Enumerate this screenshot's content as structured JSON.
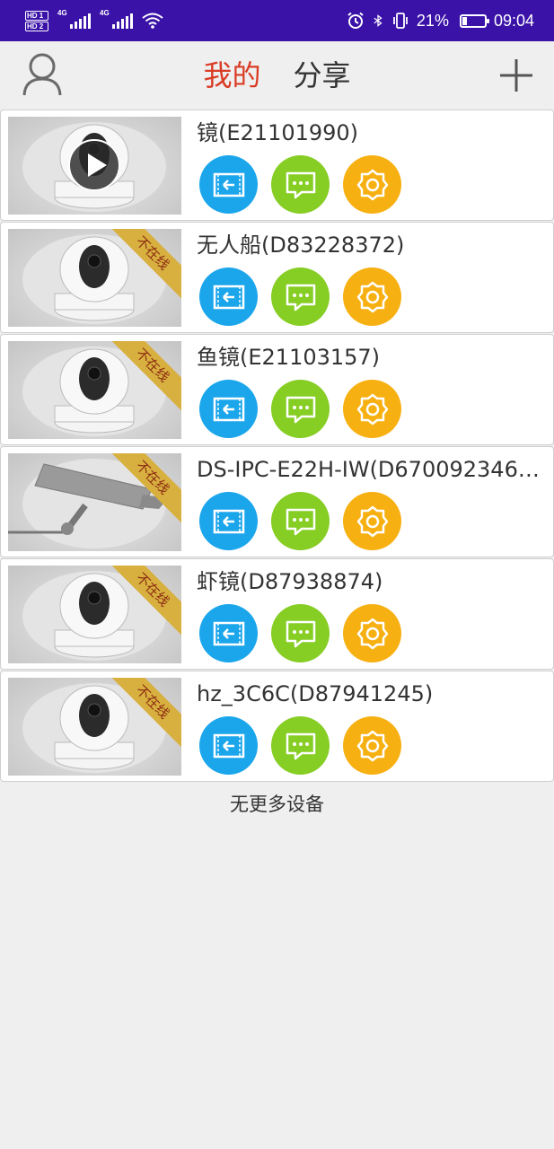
{
  "status_bar": {
    "hd1": "HD 1",
    "hd2": "HD 2",
    "net1": "4G",
    "net2": "4G",
    "battery_percent": "21%",
    "battery_level": 0.21,
    "time": "09:04"
  },
  "header": {
    "tab_mine": "我的",
    "tab_share": "分享"
  },
  "devices": [
    {
      "name": "镜(E21101990)",
      "online": true,
      "status_label": "",
      "thumb": "camera-dome"
    },
    {
      "name": "无人船(D83228372)",
      "online": false,
      "status_label": "不在线",
      "thumb": "camera-dome"
    },
    {
      "name": "鱼镜(E21103157)",
      "online": false,
      "status_label": "不在线",
      "thumb": "camera-dome"
    },
    {
      "name": "DS-IPC-E22H-IW(D670092346)...",
      "online": false,
      "status_label": "不在线",
      "thumb": "camera-bullet"
    },
    {
      "name": "虾镜(D87938874)",
      "online": false,
      "status_label": "不在线",
      "thumb": "camera-dome"
    },
    {
      "name": "hz_3C6C(D87941245)",
      "online": false,
      "status_label": "不在线",
      "thumb": "camera-dome"
    }
  ],
  "footer": {
    "no_more": "无更多设备"
  },
  "colors": {
    "status_bar": "#3a12a8",
    "active_tab": "#d93b25",
    "playback_btn": "#1ba6ec",
    "message_btn": "#86cd24",
    "settings_btn": "#f7b012",
    "offline_ribbon": "#d8b040"
  },
  "icons": {
    "playback": "playback-icon",
    "message": "message-icon",
    "settings": "settings-icon"
  }
}
